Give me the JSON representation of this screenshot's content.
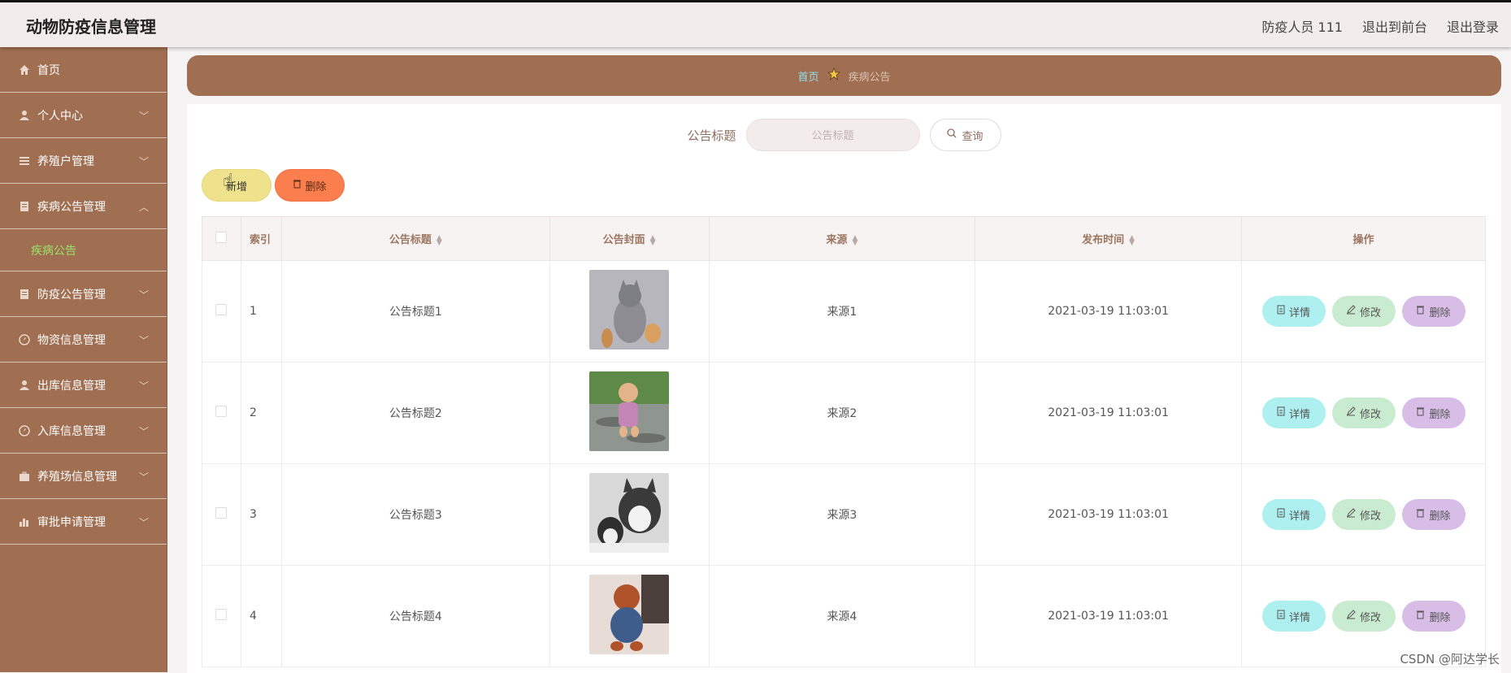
{
  "header": {
    "title": "动物防疫信息管理",
    "user": "防疫人员 111",
    "front": "退出到前台",
    "logout": "退出登录"
  },
  "sidebar": {
    "items": [
      {
        "label": "首页",
        "icon": "home-icon"
      },
      {
        "label": "个人中心",
        "icon": "user-icon"
      },
      {
        "label": "养殖户管理",
        "icon": "list-icon"
      },
      {
        "label": "疾病公告管理",
        "icon": "document-icon"
      },
      {
        "label": "防疫公告管理",
        "icon": "document-icon"
      },
      {
        "label": "物资信息管理",
        "icon": "compass-icon"
      },
      {
        "label": "出库信息管理",
        "icon": "user-icon"
      },
      {
        "label": "入库信息管理",
        "icon": "compass-icon"
      },
      {
        "label": "养殖场信息管理",
        "icon": "briefcase-icon"
      },
      {
        "label": "审批申请管理",
        "icon": "bar-chart-icon"
      }
    ],
    "sub_active": "疾病公告"
  },
  "breadcrumb": {
    "home": "首页",
    "current": "疾病公告"
  },
  "search": {
    "label": "公告标题",
    "placeholder": "公告标题",
    "button": "查询"
  },
  "toolbar": {
    "add": "新增",
    "delete": "删除"
  },
  "table": {
    "headers": [
      "索引",
      "公告标题",
      "公告封面",
      "来源",
      "发布时间",
      "操作"
    ],
    "rows": [
      {
        "index": "1",
        "title": "公告标题1",
        "source": "来源1",
        "time": "2021-03-19 11:03:01"
      },
      {
        "index": "2",
        "title": "公告标题2",
        "source": "来源2",
        "time": "2021-03-19 11:03:01"
      },
      {
        "index": "3",
        "title": "公告标题3",
        "source": "来源3",
        "time": "2021-03-19 11:03:01"
      },
      {
        "index": "4",
        "title": "公告标题4",
        "source": "来源4",
        "time": "2021-03-19 11:03:01"
      }
    ],
    "ops": {
      "detail": "详情",
      "edit": "修改",
      "delete": "删除"
    }
  },
  "watermark": "CSDN @阿达学长"
}
